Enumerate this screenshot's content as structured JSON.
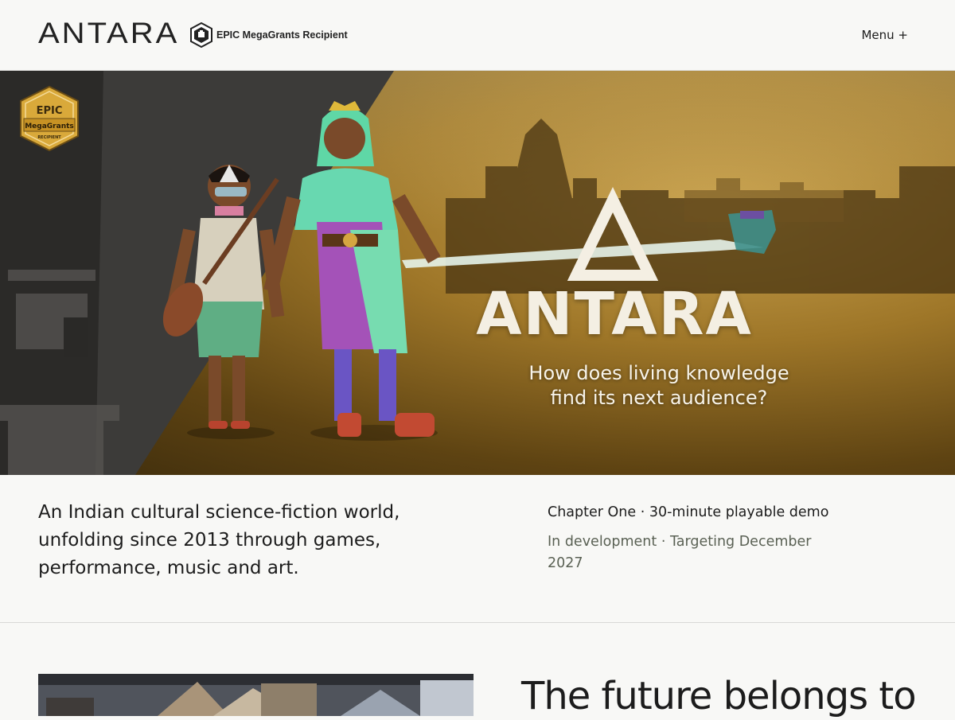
{
  "header": {
    "logo_text": "ANTARA",
    "grant_badge_label": "EPIC MegaGrants Recipient",
    "menu_label": "Menu +"
  },
  "hero": {
    "corner_badge": {
      "line1": "EPIC",
      "line2": "MegaGrants",
      "line3": "RECIPIENT"
    },
    "title": "ANTARA",
    "tagline": "How does living knowledge find its next audience?"
  },
  "intro": {
    "description": "An Indian cultural science-fiction world, unfolding since 2013 through games, performance, music and art.",
    "chapter_line": "Chapter One · 30-minute playable demo",
    "status_line": "In development · Targeting December 2027"
  },
  "next_section": {
    "heading": "The future belongs to"
  },
  "colors": {
    "page_background": "#f8f8f6",
    "text": "#1c1c1c",
    "muted_text": "#5a6154",
    "hero_gold": "#b08a3a",
    "badge_gold": "#d9a93a"
  },
  "icons": {
    "grant_badge": "epic-shield-icon",
    "hero_emblem": "triangle-emblem-icon"
  }
}
